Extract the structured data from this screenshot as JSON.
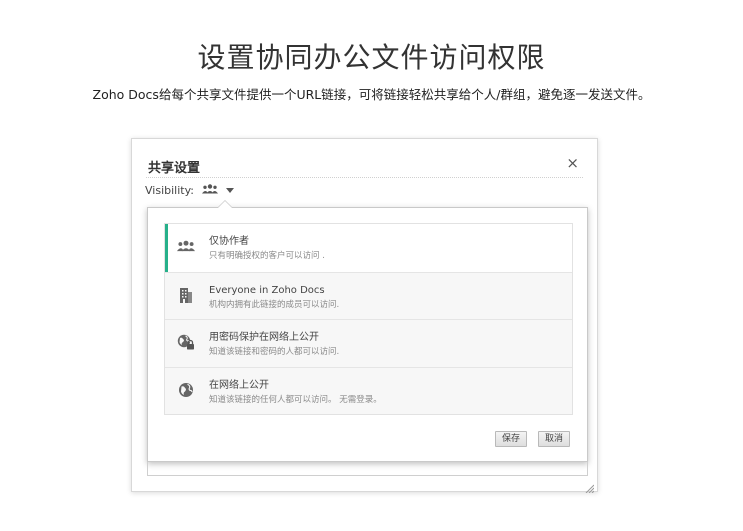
{
  "hero": {
    "title": "设置协同办公文件访问权限",
    "subtitle": "Zoho Docs给每个共享文件提供一个URL链接，可将链接轻松共享给个人/群组，避免逐一发送文件。"
  },
  "dialog": {
    "title": "共享设置",
    "close": "×",
    "visibility_label": "Visibility:",
    "visibility_icon": "group-icon",
    "options": [
      {
        "title": "仅协作者",
        "desc": "只有明确授权的客户可以访问 .",
        "icon": "collaborators-icon",
        "selected": true
      },
      {
        "title": "Everyone in Zoho Docs",
        "desc": "机构内拥有此链接的成员可以访问.",
        "icon": "organization-building-icon",
        "selected": false
      },
      {
        "title": "用密码保护在网络上公开",
        "desc": "知道该链接和密码的人都可以访问.",
        "icon": "globe-lock-icon",
        "selected": false
      },
      {
        "title": "在网络上公开",
        "desc": "知道该链接的任何人都可以访问。 无需登录。",
        "icon": "globe-icon",
        "selected": false
      }
    ],
    "save_label": "保存",
    "cancel_label": "取消"
  },
  "colors": {
    "accent": "#26b08a",
    "option_bg": "#f7f7f7",
    "border": "#d8d8d8"
  }
}
